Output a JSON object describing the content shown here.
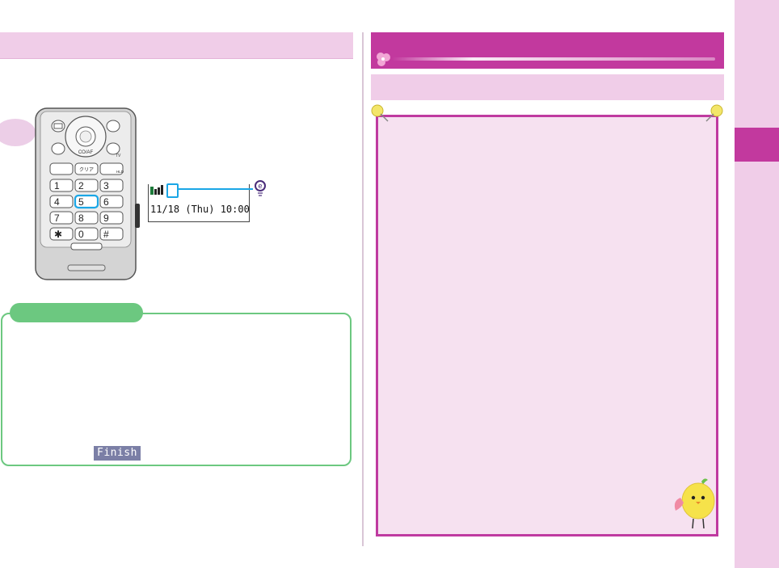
{
  "left_panel": {
    "header_title": "",
    "phone_illustration": {
      "keys": [
        {
          "label": "1",
          "kana": "あ"
        },
        {
          "label": "2",
          "kana": "か",
          "sub": "ABC"
        },
        {
          "label": "3",
          "kana": "さ",
          "sub": "DEF"
        },
        {
          "label": "4",
          "kana": "た",
          "sub": "GHI"
        },
        {
          "label": "5",
          "kana": "な",
          "sub": "JKL"
        },
        {
          "label": "6",
          "kana": "は",
          "sub": "MNO"
        },
        {
          "label": "7",
          "kana": "ま",
          "sub": "PQRS"
        },
        {
          "label": "8",
          "kana": "や",
          "sub": "TUV"
        },
        {
          "label": "9",
          "kana": "ら",
          "sub": "WXYZ"
        },
        {
          "label": "*",
          "kana": "゛゜"
        },
        {
          "label": "0",
          "kana": "わ"
        },
        {
          "label": "#",
          "kana": "、。?!"
        }
      ],
      "center_key": "CO/AF",
      "clear_key": "クリア",
      "hold_key": "HLD",
      "tv_key": "TV",
      "highlighted_key": "5"
    },
    "mini_screen": {
      "datetime": "11/18 (Thu) 10:00"
    },
    "note_box": {
      "tab_label": "",
      "finish_label": "Finish"
    }
  },
  "right_panel": {
    "header_title": "",
    "subheader_title": "",
    "tip_panel_text": ""
  },
  "colors": {
    "magenta": "#c2399e",
    "pink_light": "#f0cde8",
    "panel_pink": "#f6e1f0",
    "green": "#6cc880",
    "highlight_blue": "#1aa6e6",
    "finish_badge": "#7b7fa6"
  },
  "icons": [
    "signal-strength-icon",
    "e-indicator-icon",
    "clover-icon",
    "pushpin-icon",
    "chick-mascot-icon"
  ]
}
